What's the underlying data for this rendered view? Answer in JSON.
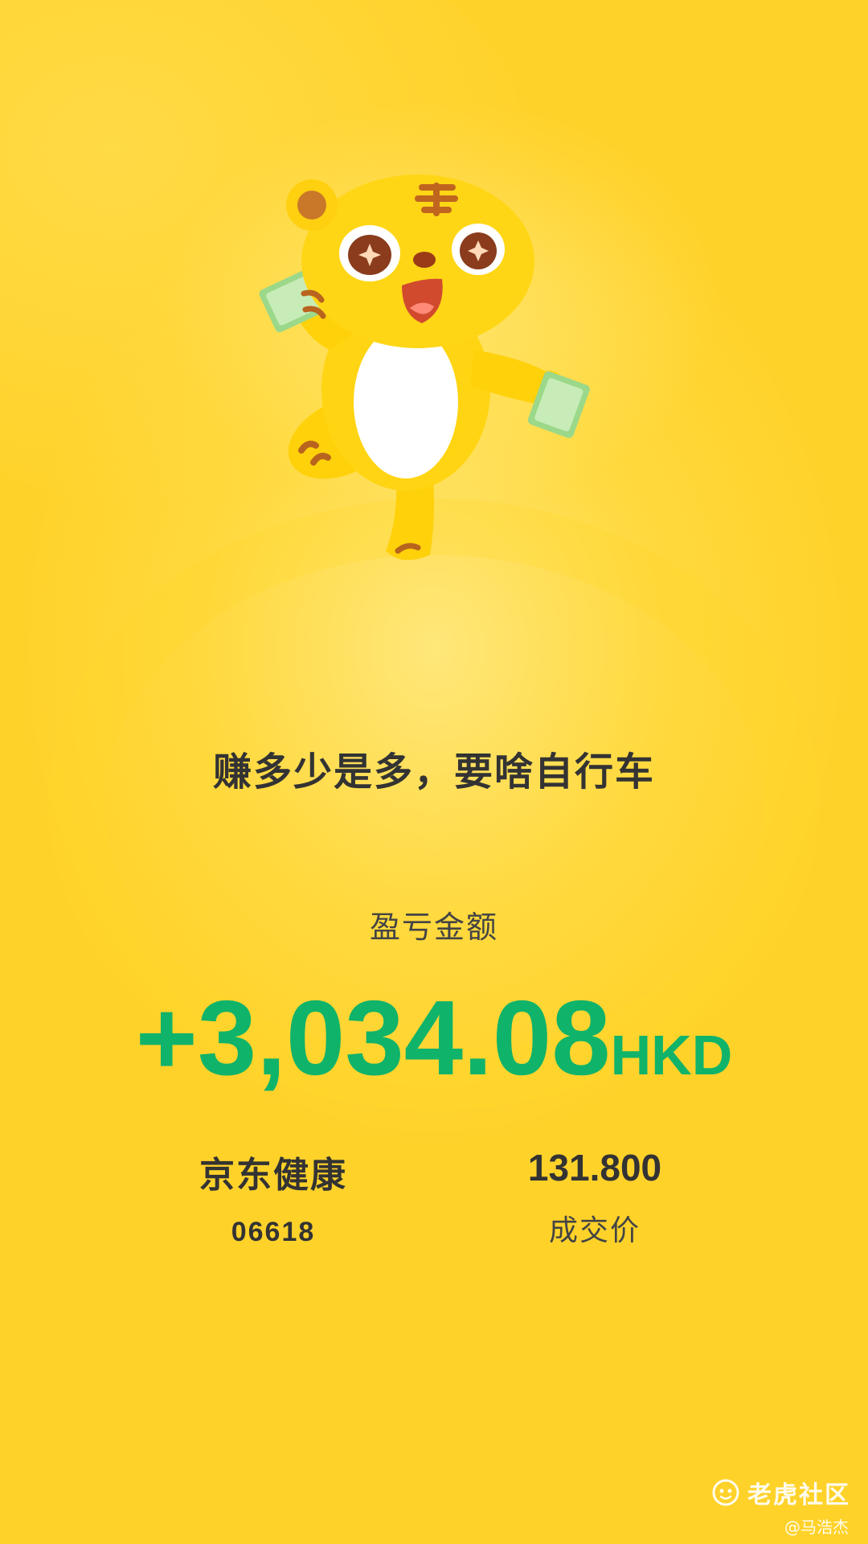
{
  "tagline": "赚多少是多，要啥自行车",
  "pnl": {
    "label": "盈亏金额",
    "amount": "+3,034.08",
    "currency": "HKD",
    "color": "#0fb36a"
  },
  "stock": {
    "name": "京东健康",
    "code": "06618"
  },
  "price": {
    "value": "131.800",
    "label": "成交价"
  },
  "watermark": {
    "brand": "老虎社区",
    "author": "@马浩杰",
    "icon": "tiger-logo-icon"
  },
  "mascot": {
    "icon": "tiger-mascot-illustration"
  },
  "colors": {
    "background": "#ffd93e",
    "text": "#333333"
  }
}
